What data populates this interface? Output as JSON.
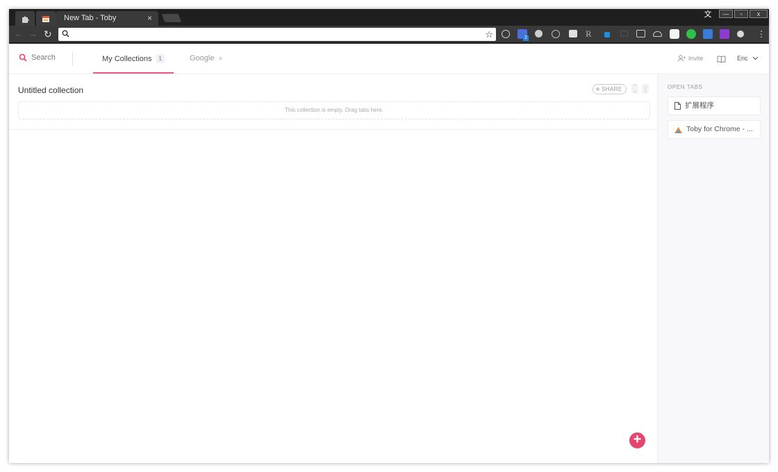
{
  "browser": {
    "active_tab_title": "New Tab - Toby",
    "tab_close_glyph": "×",
    "url": "",
    "lang_indicator": "文",
    "window_min": "—",
    "window_max": "▫",
    "window_close": "x",
    "extension_badge": "2"
  },
  "header": {
    "search_label": "Search",
    "tabs": [
      {
        "label": "My Collections",
        "count": "1",
        "active": true
      },
      {
        "label": "Google",
        "active": false
      }
    ],
    "invite_label": "Invite",
    "user_name": "Eric"
  },
  "collection": {
    "title": "Untitled collection",
    "share_label": "SHARE",
    "empty_text": "This collection is empty. Drag tabs here."
  },
  "sidebar": {
    "heading": "OPEN TABS",
    "tabs": [
      {
        "title": "扩展程序",
        "icon": "page-icon"
      },
      {
        "title": "Toby for Chrome - ...",
        "icon": "toby-favicon"
      }
    ]
  },
  "colors": {
    "accent": "#e5466e",
    "active_tab_underline": "#ea5a7a",
    "chrome_dark": "#3a3a3a"
  }
}
